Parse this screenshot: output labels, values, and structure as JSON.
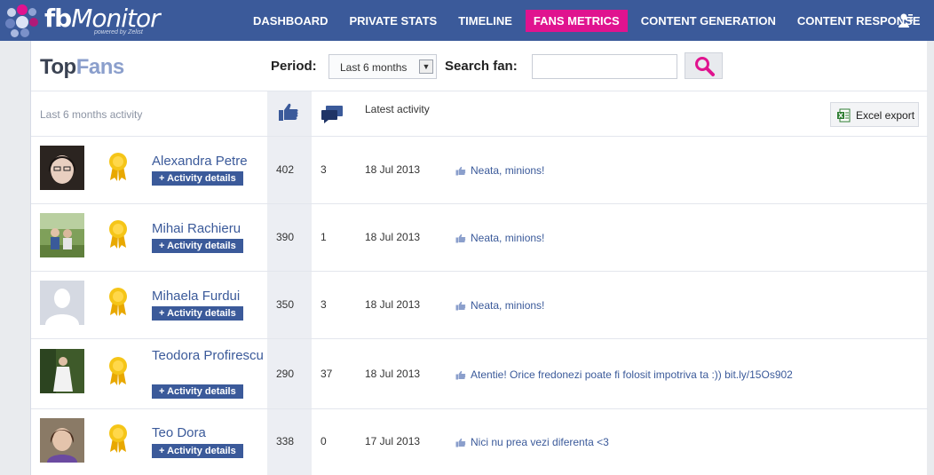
{
  "app": {
    "name_bold": "fb",
    "name_rest": "Monitor",
    "tagline": "powered by Zelist"
  },
  "nav": {
    "items": [
      {
        "label": "DASHBOARD",
        "active": false
      },
      {
        "label": "PRIVATE STATS",
        "active": false
      },
      {
        "label": "TIMELINE",
        "active": false
      },
      {
        "label": "FANS METRICS",
        "active": true
      },
      {
        "label": "CONTENT GENERATION",
        "active": false
      },
      {
        "label": "CONTENT RESPONSE",
        "active": false
      }
    ],
    "user_icon": "user-settings-icon"
  },
  "page": {
    "title_part1": "Top",
    "title_part2": "Fans",
    "period_label": "Period:",
    "period_value": "Last 6 months",
    "search_label": "Search fan:",
    "search_value": "",
    "search_icon": "magnifier-icon"
  },
  "table": {
    "caption": "Last 6 months activity",
    "likes_icon": "thumbs-up-icon",
    "comments_icon": "comments-icon",
    "latest_header": "Latest activity",
    "export_label": "Excel export",
    "details_label": "+ Activity details",
    "rows": [
      {
        "name": "Alexandra Petre",
        "likes": "402",
        "comments": "3",
        "date": "18 Jul 2013",
        "activity": "Neata, minions!"
      },
      {
        "name": "Mihai Rachieru",
        "likes": "390",
        "comments": "1",
        "date": "18 Jul 2013",
        "activity": "Neata, minions!"
      },
      {
        "name": "Mihaela Furdui",
        "likes": "350",
        "comments": "3",
        "date": "18 Jul 2013",
        "activity": "Neata, minions!"
      },
      {
        "name": "Teodora Profirescu",
        "likes": "290",
        "comments": "37",
        "date": "18 Jul 2013",
        "activity": "Atentie! Orice fredonezi poate fi folosit impotriva ta :)) bit.ly/15Os902"
      },
      {
        "name": "Teo Dora",
        "likes": "338",
        "comments": "0",
        "date": "17 Jul 2013",
        "activity": "Nici nu prea vezi diferenta <3"
      }
    ]
  },
  "colors": {
    "nav_bg": "#3b5a9a",
    "nav_active": "#e0138f",
    "link": "#3b5a9a",
    "badge": "#f5c518"
  }
}
